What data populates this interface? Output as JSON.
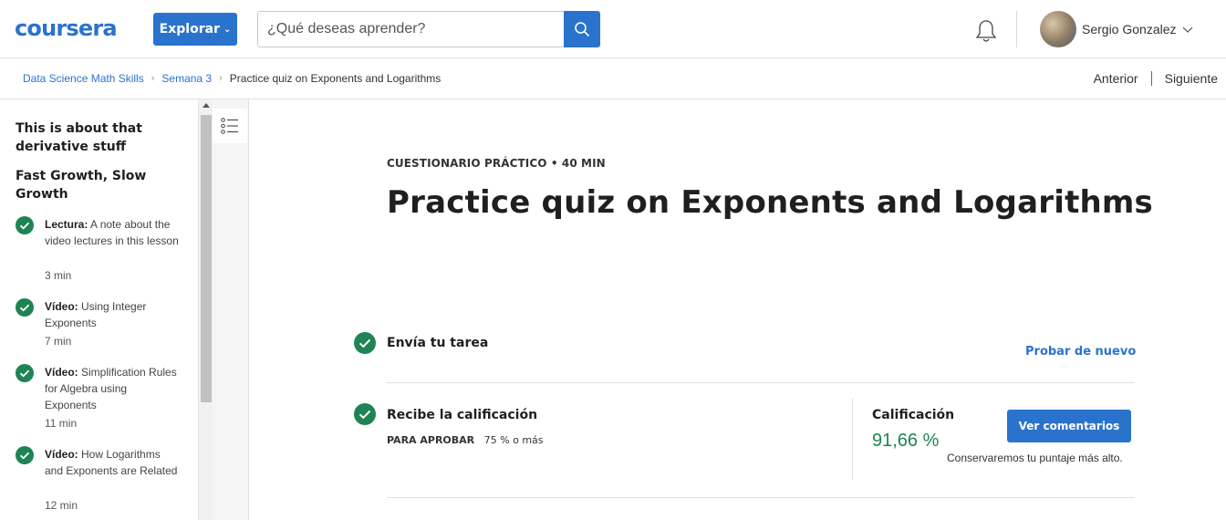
{
  "header": {
    "logo": "coursera",
    "explore_label": "Explorar",
    "search_placeholder": "¿Qué deseas aprender?",
    "user_name": "Sergio Gonzalez"
  },
  "breadcrumb": {
    "items": [
      "Data Science Math Skills",
      "Semana 3",
      "Practice quiz on Exponents and Logarithms"
    ],
    "prev_label": "Anterior",
    "next_label": "Siguiente"
  },
  "sidebar": {
    "sections": [
      "This is about that derivative stuff",
      "Fast Growth, Slow Growth"
    ],
    "items": [
      {
        "type": "Lectura:",
        "title": "A note about the video lectures in this lesson",
        "duration": "3 min"
      },
      {
        "type": "Vídeo:",
        "title": "Using Integer Exponents",
        "duration": "7 min"
      },
      {
        "type": "Vídeo:",
        "title": "Simplification Rules for Algebra using Exponents",
        "duration": "11 min"
      },
      {
        "type": "Vídeo:",
        "title": "How Logarithms and Exponents are Related",
        "duration": "12 min"
      }
    ]
  },
  "main": {
    "kicker": "CUESTIONARIO PRÁCTICO • 40 MIN",
    "title": "Practice quiz on Exponents and Logarithms",
    "step1_label": "Envía tu tarea",
    "retry_label": "Probar de nuevo",
    "step2_label": "Recibe la calificación",
    "pass_label": "PARA APROBAR",
    "pass_value": "75 % o más",
    "grade_label": "Calificación",
    "grade_value": "91,66 %",
    "feedback_label": "Ver comentarios",
    "keep_note": "Conservaremos tu puntaje más alto."
  },
  "colors": {
    "brand_blue": "#2a73cc",
    "success_green": "#1f8354"
  }
}
